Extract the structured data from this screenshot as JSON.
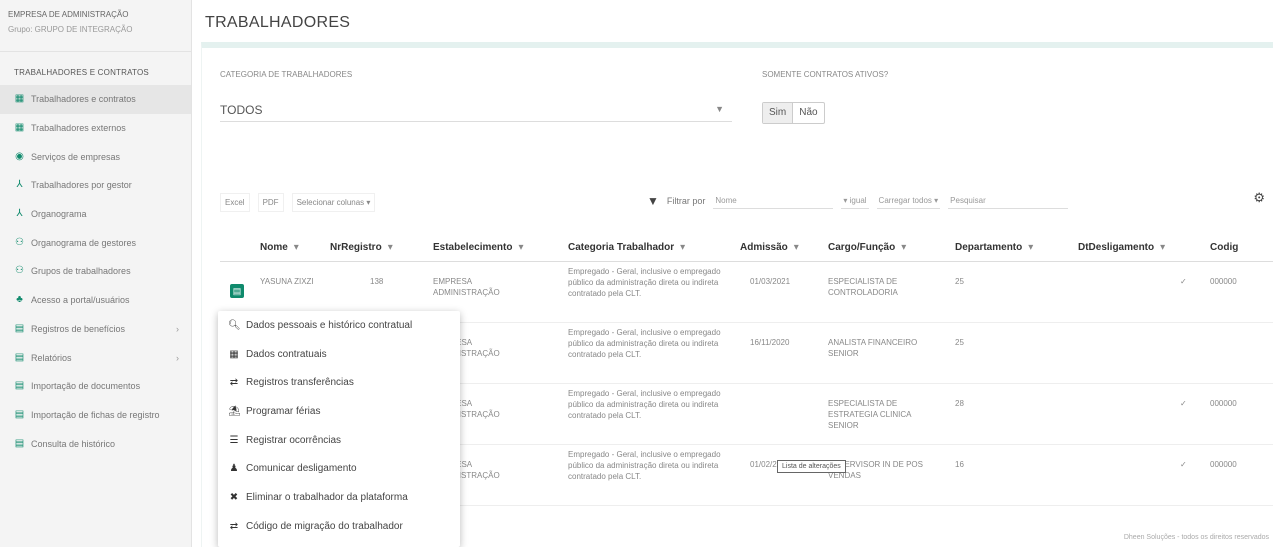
{
  "sidebar": {
    "company": "EMPRESA DE ADMINISTRAÇÃO",
    "group": "Grupo: GRUPO DE INTEGRAÇÃO",
    "section": "TRABALHADORES E CONTRATOS",
    "items": [
      {
        "label": "Trabalhadores e contratos",
        "icon": "id-card-icon",
        "glyph": "▦"
      },
      {
        "label": "Trabalhadores externos",
        "icon": "badge-icon",
        "glyph": "▦"
      },
      {
        "label": "Serviços de empresas",
        "icon": "eye-icon",
        "glyph": "◉"
      },
      {
        "label": "Trabalhadores por gestor",
        "icon": "sitemap-icon",
        "glyph": "⅄"
      },
      {
        "label": "Organograma",
        "icon": "org-chart-icon",
        "glyph": "⅄"
      },
      {
        "label": "Organograma de gestores",
        "icon": "users-icon",
        "glyph": "⚇"
      },
      {
        "label": "Grupos de trabalhadores",
        "icon": "group-icon",
        "glyph": "⚇"
      },
      {
        "label": "Acesso a portal/usuários",
        "icon": "user-key-icon",
        "glyph": "♣"
      },
      {
        "label": "Registros de benefícios",
        "icon": "file-icon",
        "glyph": "▤",
        "chevron": "›"
      },
      {
        "label": "Relatórios",
        "icon": "report-icon",
        "glyph": "▤",
        "chevron": "›"
      },
      {
        "label": "Importação de documentos",
        "icon": "import-doc-icon",
        "glyph": "▤"
      },
      {
        "label": "Importação de fichas de registro",
        "icon": "import-file-icon",
        "glyph": "▤"
      },
      {
        "label": "Consulta de histórico",
        "icon": "history-icon",
        "glyph": "▤"
      }
    ]
  },
  "page_title": "TRABALHADORES",
  "filters": {
    "category_label": "CATEGORIA DE TRABALHADORES",
    "category_value": "TODOS",
    "contracts_label": "SOMENTE CONTRATOS ATIVOS?",
    "toggle_yes": "Sim",
    "toggle_no": "Não"
  },
  "toolbar": {
    "excel": "Excel",
    "pdf": "PDF",
    "columns": "Selecionar colunas ▾",
    "filter_by": "Filtrar por",
    "filter_field": "Nome",
    "filter_op": "▾   igual",
    "load": "Carregar todos   ▾",
    "search_placeholder": "Pesquisar"
  },
  "table": {
    "headers": [
      "Nome",
      "NrRegistro",
      "Estabelecimento",
      "Categoria Trabalhador",
      "Admissão",
      "Cargo/Função",
      "Departamento",
      "DtDesligamento",
      "Codig"
    ],
    "sort_glyph": "▾",
    "rows": [
      {
        "nome": "YASUNA ZIXZI",
        "nr": "138",
        "estab": "EMPRESA ADMINISTRAÇÃO",
        "cat": "Empregado - Geral, inclusive o empregado público da administração direta ou indireta contratado pela CLT.",
        "adm": "01/03/2021",
        "cargo": "ESPECIALISTA DE CONTROLADORIA",
        "dep": "25",
        "dt": "✓",
        "cod": "000000"
      },
      {
        "nome": "",
        "nr": "",
        "estab": "EMPRESA ADMINISTRAÇÃO",
        "cat": "Empregado - Geral, inclusive o empregado público da administração direta ou indireta contratado pela CLT.",
        "adm": "16/11/2020",
        "cargo": "ANALISTA FINANCEIRO SENIOR",
        "dep": "25",
        "dt": "",
        "cod": ""
      },
      {
        "nome": "",
        "nr": "",
        "estab": "EMPRESA ADMINISTRAÇÃO",
        "cat": "Empregado - Geral, inclusive o empregado público da administração direta ou indireta contratado pela CLT.",
        "adm": "",
        "cargo": "ESPECIALISTA DE ESTRATEGIA CLINICA SENIOR",
        "dep": "28",
        "dt": "✓",
        "cod": "000000"
      },
      {
        "nome": "",
        "nr": "",
        "estab": "EMPRESA ADMINISTRAÇÃO",
        "cat": "Empregado - Geral, inclusive o empregado público da administração direta ou indireta contratado pela CLT.",
        "adm": "01/02/2022",
        "cargo": "SUPERVISOR IN DE POS VENDAS",
        "dep": "16",
        "dt": "✓",
        "cod": "000000"
      }
    ],
    "tooltip": "Lista de alterações"
  },
  "context_menu": [
    {
      "label": "Dados pessoais e histórico contratual",
      "glyph": "🔍︎",
      "icon": "search-icon"
    },
    {
      "label": "Dados contratuais",
      "glyph": "▦",
      "icon": "contract-icon"
    },
    {
      "label": "Registros transferências",
      "glyph": "⇄",
      "icon": "transfer-icon"
    },
    {
      "label": "Programar férias",
      "glyph": "⛱",
      "icon": "vacation-icon"
    },
    {
      "label": "Registrar ocorrências",
      "glyph": "☰",
      "icon": "list-icon"
    },
    {
      "label": "Comunicar desligamento",
      "glyph": "♟",
      "icon": "user-remove-icon"
    },
    {
      "label": "Eliminar o trabalhador da plataforma",
      "glyph": "✖",
      "icon": "close-icon"
    },
    {
      "label": "Código de migração do trabalhador",
      "glyph": "⇄",
      "icon": "swap-icon"
    }
  ],
  "footer": "Dheen Soluções - todos os direitos reservados",
  "colors": {
    "accent": "#0f8a6c",
    "card_top": "#e4f1ef"
  }
}
